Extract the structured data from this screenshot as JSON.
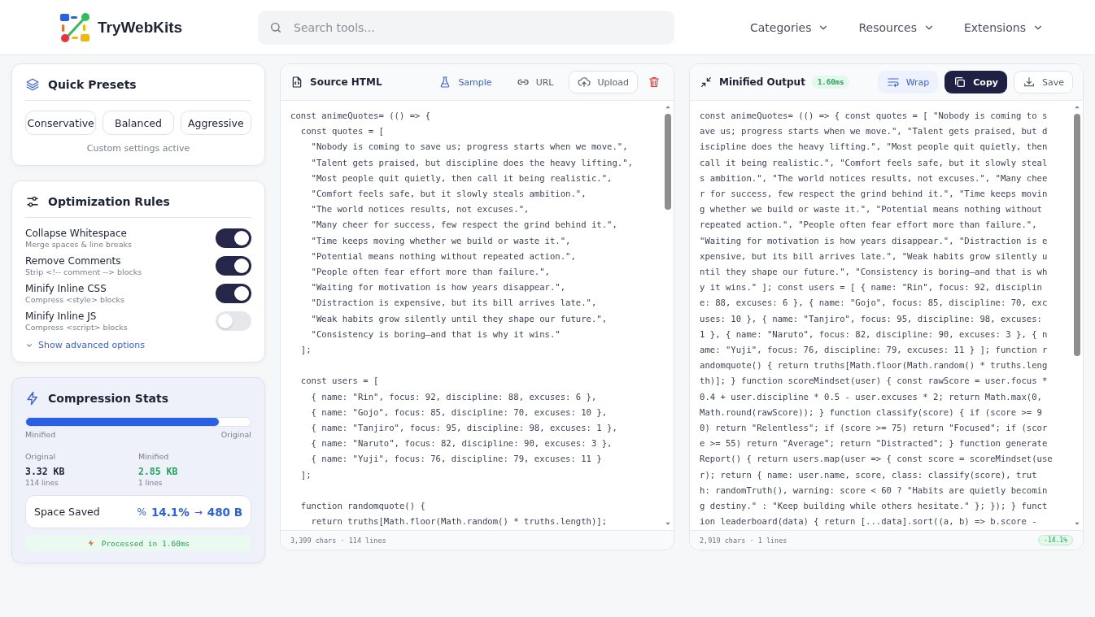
{
  "header": {
    "brand": "TryWebKits",
    "search": {
      "placeholder": "Search tools..."
    },
    "nav": [
      {
        "label": "Categories"
      },
      {
        "label": "Resources"
      },
      {
        "label": "Extensions"
      }
    ]
  },
  "presets": {
    "title": "Quick Presets",
    "items": [
      {
        "label": "Conservative",
        "selected": false
      },
      {
        "label": "Balanced",
        "selected": false
      },
      {
        "label": "Aggressive",
        "selected": false
      }
    ],
    "note": "Custom settings active"
  },
  "rules": {
    "title": "Optimization Rules",
    "items": [
      {
        "name": "Collapse Whitespace",
        "hint": "Merge spaces & line breaks",
        "on": true
      },
      {
        "name": "Remove Comments",
        "hint": "Strip <!-- comment --> blocks",
        "on": true
      },
      {
        "name": "Minify Inline CSS",
        "hint": "Compress <style> blocks",
        "on": true
      },
      {
        "name": "Minify Inline JS",
        "hint": "Compress <script> blocks",
        "on": false
      }
    ],
    "advanced_link": "Show advanced options"
  },
  "stats": {
    "title": "Compression Stats",
    "level": 0.86,
    "bar_left": "Minified",
    "bar_right": "Original",
    "columns": [
      {
        "label": "Original",
        "size": "3.32 KB",
        "lines": "114 lines",
        "kind": "original"
      },
      {
        "label": "Minified",
        "size": "2.85 KB",
        "lines": "1 lines",
        "kind": "minified"
      }
    ],
    "saved_label": "Space Saved",
    "saved_icon": "%",
    "saved_percent": "14.1%",
    "saved_arrow": "→",
    "saved_bytes": "480 B",
    "processed": "Processed in 1.60ms"
  },
  "source": {
    "title": "Source HTML",
    "actions": [
      {
        "label": "Sample",
        "kind": "sample"
      },
      {
        "label": "URL",
        "kind": "url"
      },
      {
        "label": "Upload",
        "kind": "upload"
      }
    ],
    "code": "const animeQuotes= (() => {\n  const quotes = [\n    \"Nobody is coming to save us; progress starts when we move.\",\n    \"Talent gets praised, but discipline does the heavy lifting.\",\n    \"Most people quit quietly, then call it being realistic.\",\n    \"Comfort feels safe, but it slowly steals ambition.\",\n    \"The world notices results, not excuses.\",\n    \"Many cheer for success, few respect the grind behind it.\",\n    \"Time keeps moving whether we build or waste it.\",\n    \"Potential means nothing without repeated action.\",\n    \"People often fear effort more than failure.\",\n    \"Waiting for motivation is how years disappear.\",\n    \"Distraction is expensive, but its bill arrives late.\",\n    \"Weak habits grow silently until they shape our future.\",\n    \"Consistency is boring—and that is why it wins.\"\n  ];\n\n  const users = [\n    { name: \"Rin\", focus: 92, discipline: 88, excuses: 6 },\n    { name: \"Gojo\", focus: 85, discipline: 70, excuses: 10 },\n    { name: \"Tanjiro\", focus: 95, discipline: 98, excuses: 1 },\n    { name: \"Naruto\", focus: 82, discipline: 90, excuses: 3 },\n    { name: \"Yuji\", focus: 76, discipline: 79, excuses: 11 }\n  ];\n\n  function randomquote() {\n    return truths[Math.floor(Math.random() * truths.length)];",
    "footer": "3,399 chars · 114 lines"
  },
  "output": {
    "title": "Minified Output",
    "time_badge": "1.60ms",
    "actions": [
      {
        "label": "Wrap",
        "kind": "wrap",
        "selected": true
      },
      {
        "label": "Copy",
        "kind": "copy"
      },
      {
        "label": "Save",
        "kind": "save"
      }
    ],
    "lines": [
      "const animeQuotes= (() => { const quotes = [ \"Nobody is coming to s",
      "ave us; progress starts when we move.\", \"Talent gets praised, but d",
      "iscipline does the heavy lifting.\", \"Most people quit quietly, then",
      "call it being realistic.\", \"Comfort feels safe, but it slowly steal",
      "s ambition.\", \"The world notices results, not excuses.\", \"Many chee",
      "r for success, few respect the grind behind it.\", \"Time keeps movin",
      "g whether we build or waste it.\", \"Potential means nothing without",
      "repeated action.\", \"People often fear effort more than failure.\",",
      "\"Waiting for motivation is how years disappear.\", \"Distraction is e",
      "xpensive, but its bill arrives late.\", \"Weak habits grow silently u",
      "ntil they shape our future.\", \"Consistency is boring—and that is wh",
      "y it wins.\" ]; const users = [ { name: \"Rin\", focus: 92, disciplin",
      "e: 88, excuses: 6 }, { name: \"Gojo\", focus: 85, discipline: 70, exc",
      "uses: 10 }, { name: \"Tanjiro\", focus: 95, discipline: 98, excuses:",
      "1 }, { name: \"Naruto\", focus: 82, discipline: 90, excuses: 3 }, { n",
      "ame: \"Yuji\", focus: 76, discipline: 79, excuses: 11 } ]; function r",
      "andomquote() { return truths[Math.floor(Math.random() * truths.leng",
      "th)]; } function scoreMindset(user) { const rawScore = user.focus *",
      "0.4 + user.discipline * 0.5 - user.excuses * 2; return Math.max(0,",
      "Math.round(rawScore)); } function classify(score) { if (score >= 9",
      "0) return \"Relentless\"; if (score >= 75) return \"Focused\"; if (scor",
      "e >= 55) return \"Average\"; return \"Distracted\"; } function generate",
      "Report() { return users.map(user => { const score = scoreMindset(use",
      "r); return { name: user.name, score, class: classify(score), trut",
      "h: randomTruth(), warning: score < 60 ? \"Habits are quietly becomin",
      "g destiny.\" : \"Keep building while others hesitate.\" }; }); } funct",
      "ion leaderboard(data) { return [...data].sort((a, b) => b.score -"
    ],
    "footer": "2,919 chars · 1 lines",
    "footer_badge": "-14.1%"
  }
}
